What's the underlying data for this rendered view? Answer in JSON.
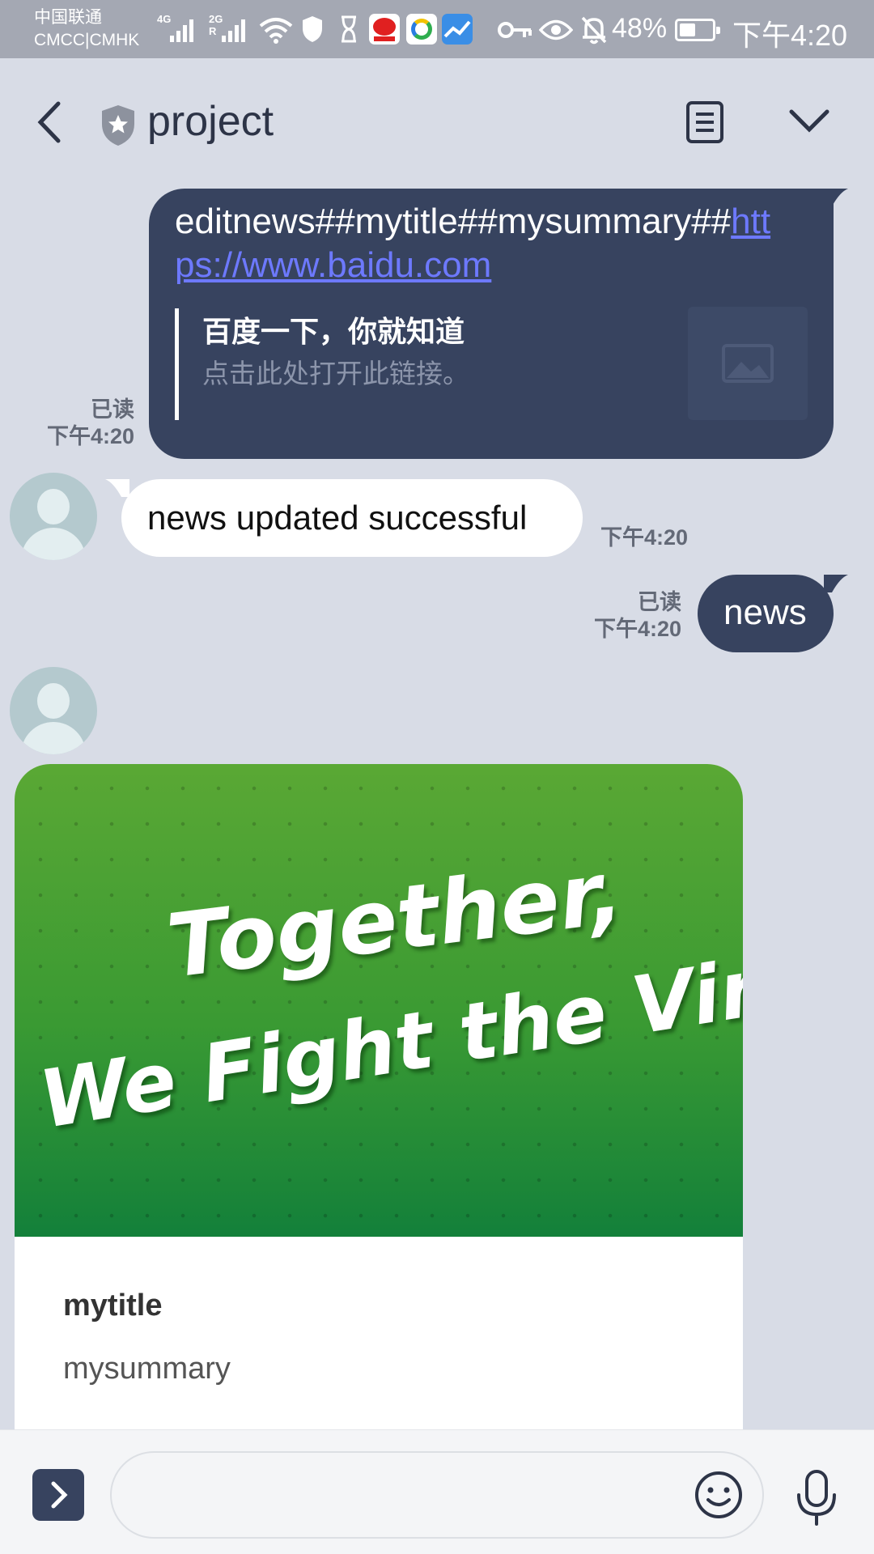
{
  "status_bar": {
    "carrier_line1": "中国联通",
    "carrier_line2": "CMCC|CMHK",
    "sig1_tag": "4G",
    "sig2_tag": "2G R",
    "battery_percent": "48%",
    "battery_level": 0.48,
    "time": "下午4:20",
    "icons": [
      "wifi-icon",
      "shield-icon",
      "hourglass-icon",
      "app-icon",
      "app-icon",
      "app-icon",
      "key-icon",
      "eye-icon",
      "bell-off-icon",
      "battery-icon"
    ]
  },
  "header": {
    "title": "project",
    "icons": [
      "back-arrow-icon",
      "shield-star-icon",
      "notes-icon",
      "chevron-down-icon"
    ]
  },
  "messages": [
    {
      "type": "sent-link",
      "text_prefix": "editnews##mytitle##mysummary##",
      "link": "https://www.baidu.com",
      "preview_title": "百度一下，你就知道",
      "preview_desc": "点击此处打开此链接。",
      "read": "已读",
      "time": "下午4:20"
    },
    {
      "type": "received",
      "text": "news updated successful",
      "time": "下午4:20"
    },
    {
      "type": "sent",
      "text": "news",
      "read": "已读",
      "time": "下午4:20"
    },
    {
      "type": "received-card",
      "image_line1": "Together,",
      "image_line2": "We Fight the Virus!",
      "title": "mytitle",
      "summary": "mysummary"
    }
  ],
  "input_bar": {
    "value": "",
    "icons": [
      "chevron-right-icon",
      "emoji-icon",
      "microphone-icon"
    ]
  },
  "colors": {
    "background": "#d8dce6",
    "sent_bubble": "#37435f",
    "received_bubble": "#ffffff",
    "link": "#6d79ff",
    "status_bar": "#a4a8b3"
  }
}
